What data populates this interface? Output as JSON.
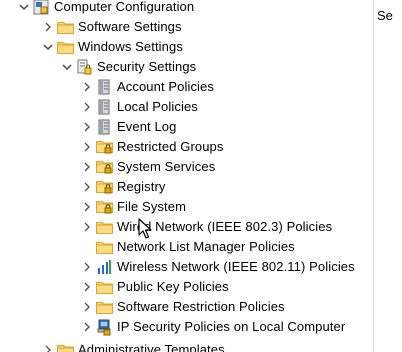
{
  "tree": {
    "root": {
      "label": "Computer Configuration",
      "icon": "computer-config-icon"
    },
    "software_settings": {
      "label": "Software Settings",
      "icon": "folder-icon"
    },
    "windows_settings": {
      "label": "Windows Settings",
      "icon": "folder-icon"
    },
    "security_settings": {
      "label": "Security Settings",
      "icon": "security-settings-icon"
    },
    "children": [
      {
        "label": "Account Policies",
        "icon": "policy-book-icon"
      },
      {
        "label": "Local Policies",
        "icon": "policy-book-icon"
      },
      {
        "label": "Event Log",
        "icon": "policy-book-icon"
      },
      {
        "label": "Restricted Groups",
        "icon": "locked-folder-icon"
      },
      {
        "label": "System Services",
        "icon": "locked-folder-icon"
      },
      {
        "label": "Registry",
        "icon": "locked-folder-icon"
      },
      {
        "label": "File System",
        "icon": "locked-folder-icon"
      },
      {
        "label": "Wired Network (IEEE 802.3) Policies",
        "icon": "folder-icon"
      },
      {
        "label": "Network List Manager Policies",
        "icon": "folder-icon"
      },
      {
        "label": "Wireless Network (IEEE 802.11) Policies",
        "icon": "wireless-network-icon"
      },
      {
        "label": "Public Key Policies",
        "icon": "folder-icon"
      },
      {
        "label": "Software Restriction Policies",
        "icon": "folder-icon"
      },
      {
        "label": "IP Security Policies on Local Computer",
        "icon": "ip-security-icon"
      }
    ],
    "administrative_templates": {
      "label": "Administrative Templates",
      "icon": "folder-icon"
    }
  },
  "right_pane": {
    "header": "Se"
  }
}
